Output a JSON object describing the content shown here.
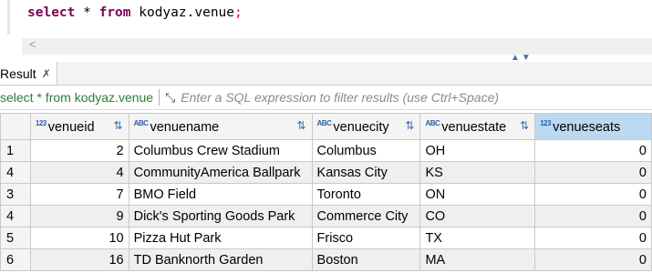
{
  "editor": {
    "keyword_select": "select",
    "star": " * ",
    "keyword_from": "from",
    "table_ref": " kodyaz.venue",
    "semicolon": ";",
    "scroll_left_arrow": "<"
  },
  "results_panel": {
    "tab_label": "Result",
    "tab_close": "✗",
    "query_label": "select * from kodyaz.venue",
    "filter_placeholder": "Enter a SQL expression to filter results (use Ctrl+Space)"
  },
  "grid": {
    "columns": [
      {
        "name": "venueid",
        "type_badge": "123"
      },
      {
        "name": "venuename",
        "type_badge": "ABC"
      },
      {
        "name": "venuecity",
        "type_badge": "ABC"
      },
      {
        "name": "venuestate",
        "type_badge": "ABC"
      },
      {
        "name": "venueseats",
        "type_badge": "123"
      }
    ],
    "sort_icon": "⇅",
    "rows": [
      {
        "n": "1",
        "venueid": "2",
        "venuename": "Columbus Crew Stadium",
        "venuecity": "Columbus",
        "venuestate": "OH",
        "venueseats": "0"
      },
      {
        "n": "4",
        "venueid": "4",
        "venuename": "CommunityAmerica Ballpark",
        "venuecity": "Kansas City",
        "venuestate": "KS",
        "venueseats": "0"
      },
      {
        "n": "3",
        "venueid": "7",
        "venuename": "BMO Field",
        "venuecity": "Toronto",
        "venuestate": "ON",
        "venueseats": "0"
      },
      {
        "n": "4",
        "venueid": "9",
        "venuename": "Dick's Sporting Goods Park",
        "venuecity": "Commerce City",
        "venuestate": "CO",
        "venueseats": "0"
      },
      {
        "n": "5",
        "venueid": "10",
        "venuename": "Pizza Hut Park",
        "venuecity": "Frisco",
        "venuestate": "TX",
        "venueseats": "0"
      },
      {
        "n": "6",
        "venueid": "16",
        "venuename": "TD Banknorth Garden",
        "venuecity": "Boston",
        "venuestate": "MA",
        "venueseats": "0"
      }
    ]
  }
}
